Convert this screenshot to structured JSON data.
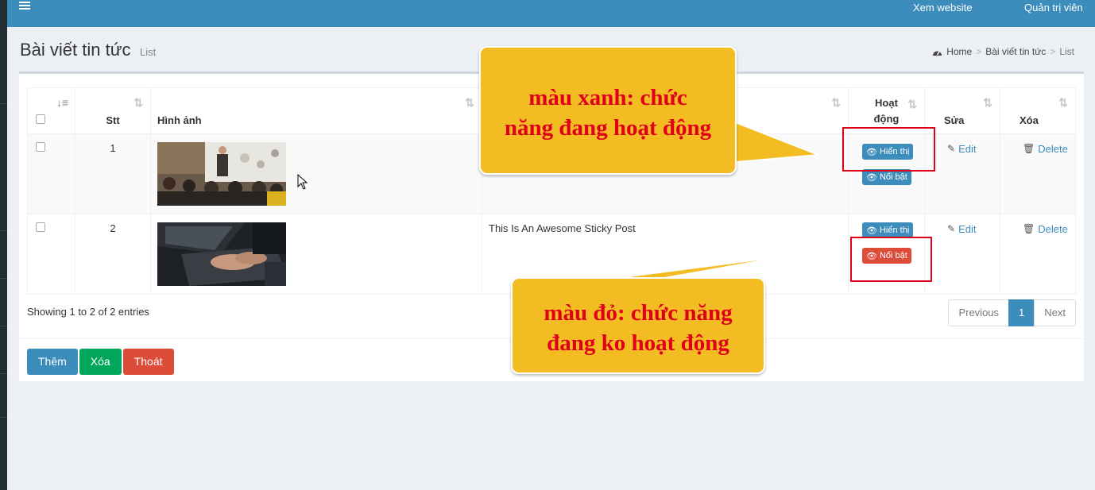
{
  "topbar": {
    "view_site": "Xem website",
    "admin": "Quản trị viên"
  },
  "header": {
    "title": "Bài viết tin tức",
    "subtitle": "List"
  },
  "breadcrumb": {
    "home": "Home",
    "section": "Bài viết tin tức",
    "current": "List"
  },
  "table": {
    "columns": {
      "stt": "Stt",
      "image": "Hình ảnh",
      "status_line1": "Hoạt",
      "status_line2": "động",
      "edit": "Sửa",
      "delete": "Xóa"
    },
    "rows": [
      {
        "stt": "1",
        "title": "",
        "show_label": "Hiển thị",
        "show_state": "active",
        "featured_label": "Nổi bật",
        "featured_state": "active",
        "edit": "Edit",
        "delete": "Delete"
      },
      {
        "stt": "2",
        "title": "This Is An Awesome Sticky Post",
        "show_label": "Hiển thị",
        "show_state": "active",
        "featured_label": "Nổi bật",
        "featured_state": "inactive",
        "edit": "Edit",
        "delete": "Delete"
      }
    ]
  },
  "footer": {
    "info": "Showing 1 to 2 of 2 entries",
    "prev": "Previous",
    "page": "1",
    "next": "Next"
  },
  "actions": {
    "add": "Thêm",
    "delete": "Xóa",
    "exit": "Thoát"
  },
  "annotations": {
    "blue_line1": "màu xanh: chức",
    "blue_line2": "năng đang hoạt động",
    "red_line1": "màu đỏ: chức năng",
    "red_line2": "đang ko hoạt động"
  },
  "colors": {
    "primary": "#3c8dbc",
    "danger": "#dd4b39",
    "success": "#00a65a",
    "callout": "#f3bc22",
    "annotation_text": "#e0001a"
  },
  "icons": [
    "menu-icon",
    "sort-icon",
    "dashboard-icon",
    "eye-icon",
    "pencil-icon",
    "trash-icon",
    "mouse-cursor-icon"
  ]
}
